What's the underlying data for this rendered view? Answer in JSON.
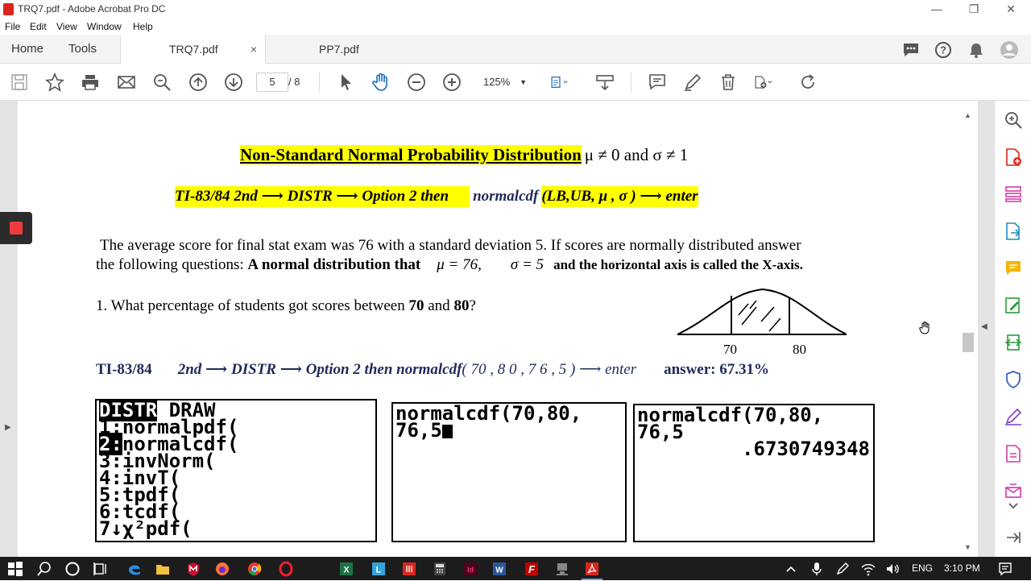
{
  "window": {
    "title": "TRQ7.pdf - Adobe Acrobat Pro DC"
  },
  "menu": [
    "File",
    "Edit",
    "View",
    "Window",
    "Help"
  ],
  "tabs": {
    "home": "Home",
    "tools": "Tools",
    "active_doc": "TRQ7.pdf",
    "other_doc": "PP7.pdf",
    "close": "×"
  },
  "toolbar": {
    "page_current": "5",
    "page_total": "/ 8",
    "zoom": "125%"
  },
  "doc": {
    "heading_highlight": "Non-Standard Normal Probability Distribution",
    "heading_rest": "μ ≠ 0  and  σ ≠ 1",
    "ti_line_highlight": "TI-83/84      2nd ⟶ DISTR ⟶ Option 2    then",
    "ti_line_mid": "normalcdf",
    "ti_line_end": "(LB,UB,  μ , σ )  ⟶  enter",
    "para_line1": "The average score for final stat exam was 76 with a standard deviation 5.  If scores are normally distributed answer",
    "para_line2_a": "the following questions: ",
    "para_line2_b": "A normal distribution that",
    "para_line2_c": "μ = 76,",
    "para_line2_d": "σ = 5",
    "para_line2_e": "and the horizontal axis is called the X-axis.",
    "q1_a": "1. What percentage of students got scores between ",
    "q1_b": "70",
    "q1_c": " and ",
    "q1_d": "80",
    "q1_e": "?",
    "curve_label_left": "70",
    "curve_label_right": "80",
    "answer_line_a": "TI-83/84",
    "answer_line_b": "2nd ⟶ DISTR ⟶ Option 2    then    normalcdf",
    "answer_line_c": "( 70 , 8 0 , 7 6  , 5 )  ⟶  enter",
    "answer_line_d": "answer: 67.31%"
  },
  "calc1": {
    "menu_active": "DISTR",
    "menu_other": "DRAW",
    "items": [
      {
        "num": "1:",
        "text": "normalpdf("
      },
      {
        "num": "2:",
        "text": "normalcdf("
      },
      {
        "num": "3:",
        "text": "invNorm("
      },
      {
        "num": "4:",
        "text": "invT("
      },
      {
        "num": "5:",
        "text": "tpdf("
      },
      {
        "num": "6:",
        "text": "tcdf("
      },
      {
        "num": "7↓",
        "text": "χ²pdf("
      }
    ]
  },
  "calc2": {
    "line1": "normalcdf(70,80,",
    "line2": "76,5"
  },
  "calc3": {
    "line1": "normalcdf(70,80,",
    "line2": "76,5",
    "result": ".6730749348"
  },
  "taskbar": {
    "lang": "ENG",
    "time": "3:10 PM"
  }
}
